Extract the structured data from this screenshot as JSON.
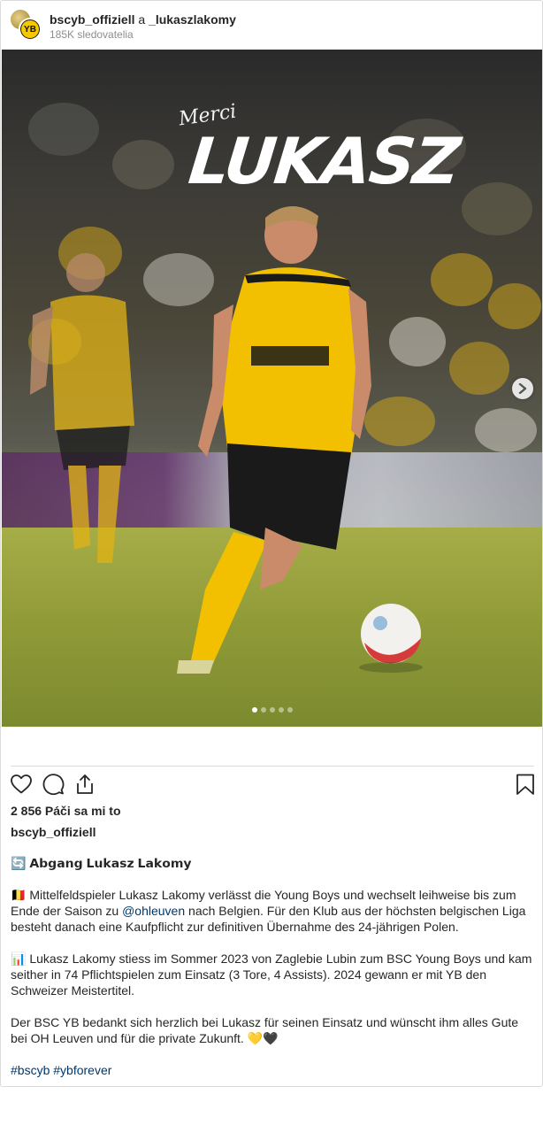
{
  "header": {
    "account_primary": "bscyb_offiziell",
    "conjunction": "a",
    "account_secondary": "_lukaszlakomy",
    "followers": "185K sledovatelia",
    "avatar_front_text": "YB"
  },
  "photo": {
    "overlay_script": "Merci",
    "overlay_name": "LUKASZ",
    "slide_count": 5,
    "active_slide": 1,
    "next_icon": "chevron-right-icon"
  },
  "actions": {
    "like_icon": "heart-icon",
    "comment_icon": "comment-icon",
    "share_icon": "share-icon",
    "save_icon": "bookmark-icon"
  },
  "likes": "2 856 Páči sa mi to",
  "owner": "bscyb_offiziell",
  "caption": {
    "line1": "🔄 𝗔𝗯𝗴𝗮𝗻𝗴 𝗟𝘂𝗸𝗮𝘀𝘇 𝗟𝗮𝗸𝗼𝗺𝘆",
    "para2_prefix": "🇧🇪 Mittelfeldspieler Lukasz Lakomy verlässt die Young Boys und wechselt leihweise bis zum Ende der Saison zu ",
    "para2_link": "@ohleuven",
    "para2_suffix": " nach Belgien. Für den Klub aus der höchsten belgischen Liga besteht danach eine Kaufpflicht zur definitiven Übernahme des 24-jährigen Polen.",
    "para3": "📊 Lukasz Lakomy stiess im Sommer 2023 von Zaglebie Lubin zum BSC Young Boys und kam seither in 74 Pflichtspielen zum Einsatz (3 Tore, 4 Assists). 2024 gewann er mit YB den Schweizer Meistertitel.",
    "para4": "Der BSC YB bedankt sich herzlich bei Lukasz für seinen Einsatz und wünscht ihm alles Gute bei OH Leuven und für die private Zukunft. 💛🖤",
    "hashtag1": "#bscyb",
    "hashtag2": "#ybforever"
  }
}
